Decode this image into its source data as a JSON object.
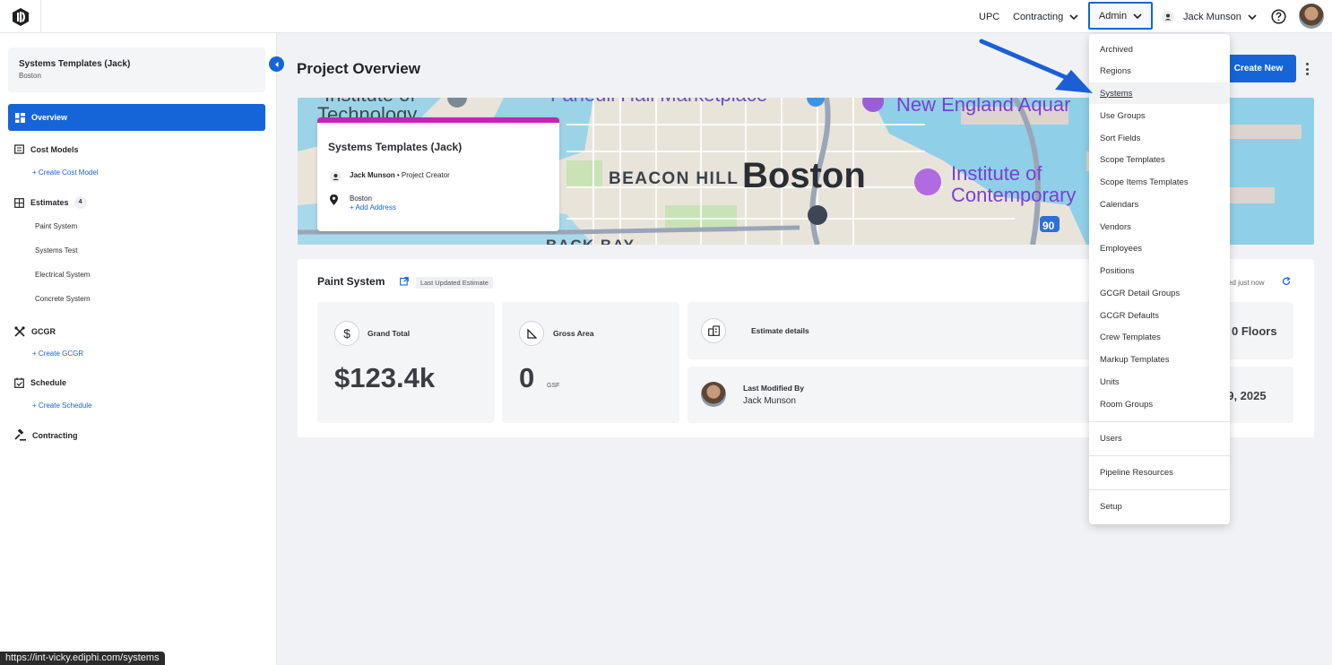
{
  "topbar": {
    "nav": [
      "UPC",
      "Contracting",
      "Admin"
    ],
    "user_name": "Jack Munson"
  },
  "sidebar": {
    "project_title": "Systems Templates (Jack)",
    "project_location": "Boston",
    "overview": "Overview",
    "cost_models": "Cost Models",
    "create_cost_model": "+ Create Cost Model",
    "estimates": "Estimates",
    "estimates_count": "4",
    "estimate_items": [
      "Paint System",
      "Systems Test",
      "Electrical System",
      "Concrete System"
    ],
    "gcgr": "GCGR",
    "create_gcgr": "+ Create GCGR",
    "schedule": "Schedule",
    "create_schedule": "+ Create Schedule",
    "contracting": "Contracting"
  },
  "main": {
    "page_title": "Project Overview",
    "create_new": "Create New",
    "map_card": {
      "title": "Systems Templates (Jack)",
      "creator_name": "Jack Munson",
      "creator_role": " • Project Creator",
      "location": "Boston",
      "add_address": "+ Add Address"
    },
    "map_labels": {
      "tech1": "Institute of",
      "tech2": "Technology",
      "marketplace": "Faneuil Hall Marketplace",
      "aquarium": "New England Aquar",
      "beacon": "BEACON HILL",
      "boston": "Boston",
      "ica1": "Institute of",
      "ica2": "Contemporary",
      "backbay": "BACK BAY",
      "route": "90"
    },
    "estimate": {
      "title": "Paint System",
      "tag": "Last Updated Estimate",
      "updated": "ed just now",
      "grand_total_label": "Grand Total",
      "grand_total_value": "$123.4k",
      "gross_area_label": "Gross Area",
      "gross_area_value": "0",
      "gross_area_unit": "GSF",
      "details_label": "Estimate details",
      "floors": "0 Floors",
      "last_modified_label": "Last Modified By",
      "last_modified_name": "Jack Munson",
      "last_modified_date": "29, 2025"
    }
  },
  "admin_menu": {
    "items": [
      "Archived",
      "Regions",
      "Systems",
      "Use Groups",
      "Sort Fields",
      "Scope Templates",
      "Scope Items Templates",
      "Calendars",
      "Vendors",
      "Employees",
      "Positions",
      "GCGR Detail Groups",
      "GCGR Defaults",
      "Crew Templates",
      "Markup Templates",
      "Units",
      "Room Groups"
    ],
    "users": "Users",
    "pipeline": "Pipeline Resources",
    "setup": "Setup"
  },
  "status_url": "https://int-vicky.ediphi.com/systems",
  "colors": {
    "accent": "#1565d8",
    "map_card_accent": "#c823b4"
  }
}
